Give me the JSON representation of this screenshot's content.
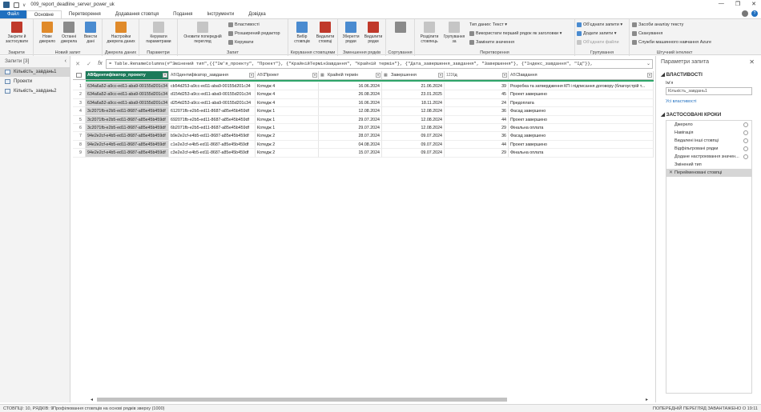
{
  "titlebar": {
    "filename": "009_report_deadline_server_power_uk",
    "caret": "∨"
  },
  "tabs": [
    "Файл",
    "Основне",
    "Перетворення",
    "Додавання стовпця",
    "Подання",
    "Інструменти",
    "Довідка"
  ],
  "ribbon": {
    "groups": {
      "close": "Закрити",
      "new_query": "Новий запит",
      "data_sources": "Джерела даних",
      "params": "Параметри",
      "query": "Запит",
      "manage_cols": "Керування стовпцями",
      "reduce_rows": "Зменшення рядків",
      "sort": "Сортування",
      "transform": "Перетворення",
      "combine": "Групування",
      "ai": "Штучний інтелект"
    },
    "buttons": {
      "close_apply": "Закрити й застосувати",
      "new_source": "Нове джерело",
      "recent_sources": "Останні джерела",
      "enter_data": "Ввести дані",
      "source_settings": "Настройки джерела даних",
      "manage_params": "Керувати параметрами",
      "refresh_preview": "Оновити попередній перегляд",
      "properties": "Властивості",
      "advanced_editor": "Розширений редактор",
      "manage": "Керувати",
      "choose_cols": "Вибір стовпців",
      "remove_cols": "Видалити стовпці",
      "keep_rows": "Зберегти рядки",
      "remove_rows": "Видалити рядки",
      "split_col": "Розділити стовпець",
      "group_by": "Групування за",
      "data_type": "Тип даних: Текст",
      "first_row_headers": "Використати перший рядок як заголовки",
      "replace_values": "Замінити значення",
      "merge_queries": "Об'єднати запити",
      "append_queries": "Додати запити",
      "combine_files": "Об'єднати файли",
      "text_analytics": "Засоби аналізу тексту",
      "vision": "Сканування",
      "azure_ml": "Служби машинного навчання Azure"
    }
  },
  "queries_pane": {
    "header": "Запити [3]",
    "items": [
      "Кількість_завдань1",
      "Проекти",
      "Кількість_завдань2"
    ],
    "selected_index": 0
  },
  "formula_bar": {
    "cancel": "✕",
    "confirm": "✓",
    "fx": "fx",
    "formula": "= Table.RenameColumns(#\"Змінений тип\",{{\"Ім'я_проекту\", \"Проект\"}, {\"КрайнійТермінЗавдання\", \"Крайній термін\"}, {\"Дата_завершення_завдання\", \"Завершення\"}, {\"Індекс_завдання\", \"Ід\"}},"
  },
  "grid": {
    "columns": [
      {
        "type": "ABC",
        "name": "Ідентифікатор_проекту",
        "selected": true
      },
      {
        "type": "ABC",
        "name": "Ідентифікатор_завдання"
      },
      {
        "type": "ABC",
        "name": "Проект"
      },
      {
        "type": "▦",
        "name": "Крайній термін"
      },
      {
        "type": "▦",
        "name": "Завершення"
      },
      {
        "type": "123",
        "name": "Ід"
      },
      {
        "type": "ABC",
        "name": "Завдання"
      }
    ],
    "rows": [
      [
        "1",
        "634a6a52-a9cc-ed11-aba9-00155d201c34",
        "cb54d253-a9cc-ed11-aba9-00155d201c34",
        "Котедж 4",
        "16.06.2024",
        "21.06.2024",
        "39",
        "Розробка та затвердження КП і підписання договору (благоустрій т..."
      ],
      [
        "2",
        "634a6a52-a9cc-ed11-aba9-00155d201c34",
        "d154d253-a9cc-ed11-aba9-00155d201c34",
        "Котедж 4",
        "26.08.2024",
        "23.01.2025",
        "45",
        "Проект завершено"
      ],
      [
        "3",
        "634a6a52-a9cc-ed11-aba9-00155d201c34",
        "d254d253-a9cc-ed11-aba9-00155d201c34",
        "Котедж 4",
        "16.06.2024",
        "18.11.2024",
        "24",
        "Предоплата"
      ],
      [
        "4",
        "3c2071fb-e2b5-ed11-8687-a85e45b459df",
        "612071fb-e2b5-ed11-8687-a85e45b459df",
        "Котедж 1",
        "12.08.2024",
        "12.08.2024",
        "36",
        "Фасад завершено"
      ],
      [
        "5",
        "3c2071fb-e2b5-ed11-8687-a85e45b459df",
        "692071fb-e2b5-ed11-8687-a85e45b459df",
        "Котедж 1",
        "29.07.2024",
        "12.08.2024",
        "44",
        "Проект завершено"
      ],
      [
        "6",
        "3c2071fb-e2b5-ed11-8687-a85e45b459df",
        "6b2071fb-e2b5-ed11-8687-a85e45b459df",
        "Котедж 1",
        "29.07.2024",
        "12.08.2024",
        "29",
        "Фінальна оплата"
      ],
      [
        "7",
        "94e2e2cf-e4b5-ed11-8687-a85e45b459df",
        "b9e2e2cf-e4b5-ed11-8687-a85e45b459df",
        "Котедж 2",
        "28.07.2024",
        "09.07.2024",
        "36",
        "Фасад завершено"
      ],
      [
        "8",
        "94e2e2cf-e4b5-ed11-8687-a85e45b459df",
        "c1e2e2cf-e4b5-ed11-8687-a85e45b459df",
        "Котедж 2",
        "04.08.2024",
        "09.07.2024",
        "44",
        "Проект завершено"
      ],
      [
        "9",
        "94e2e2cf-e4b5-ed11-8687-a85e45b459df",
        "c3e2e2cf-e4b5-ed11-8687-a85e45b459df",
        "Котедж 2",
        "15.07.2024",
        "09.07.2024",
        "29",
        "Фінальна оплата"
      ]
    ]
  },
  "settings_pane": {
    "title": "Параметри запита",
    "properties_header": "ВЛАСТИВОСТІ",
    "name_label": "Ім'я",
    "name_value": "Кількість_завдань1",
    "all_properties": "Усі властивості",
    "steps_header": "ЗАСТОСОВАНІ КРОКИ",
    "steps": [
      {
        "name": "Джерело",
        "gear": true
      },
      {
        "name": "Навігація",
        "gear": true
      },
      {
        "name": "Видалені інші стовпці",
        "gear": true
      },
      {
        "name": "Відфільтровані рядки",
        "gear": true
      },
      {
        "name": "Додане настроювання значен...",
        "gear": true
      },
      {
        "name": "Змінений тип",
        "gear": false
      },
      {
        "name": "Перейменовані стовпці",
        "gear": false,
        "current": true
      }
    ]
  },
  "statusbar": {
    "left": "СТОВПЦІ: 10, РЯДКІВ: 9",
    "mid": "Профілювання стовпців на основі рядків зверху (1000)",
    "right": "ПОПЕРЕДНІЙ ПЕРЕГЛЯД ЗАВАНТАЖЕНО О 19:11"
  }
}
